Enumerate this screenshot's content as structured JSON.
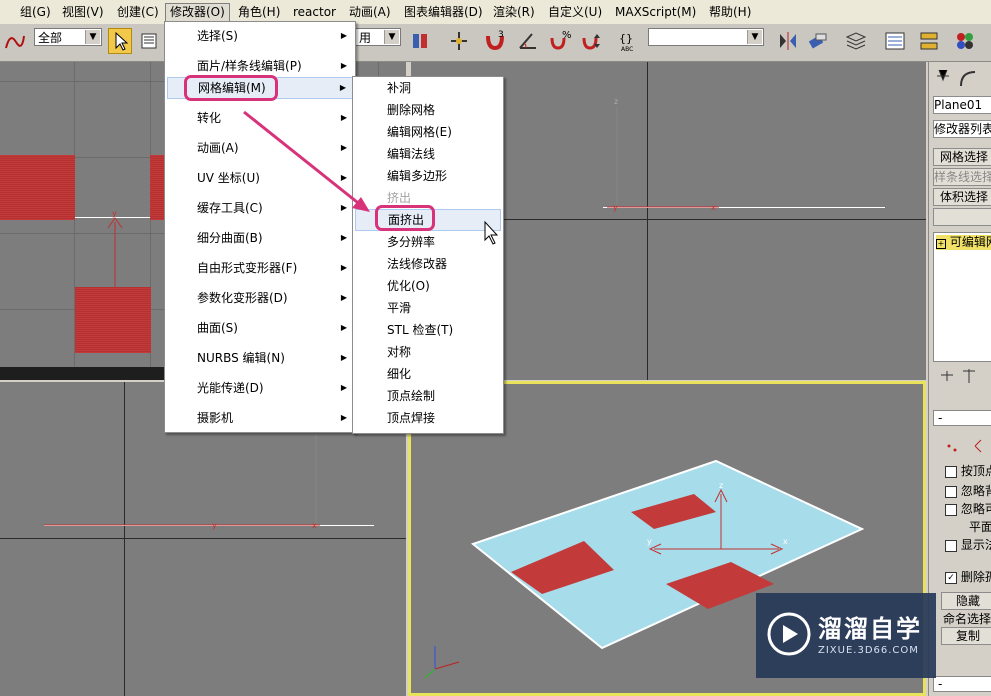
{
  "menubar": {
    "items": [
      "组(G)",
      "视图(V)",
      "创建(C)",
      "修改器(O)",
      "角色(H)",
      "reactor",
      "动画(A)",
      "图表编辑器(D)",
      "渲染(R)",
      "自定义(U)",
      "MAXScript(M)",
      "帮助(H)"
    ]
  },
  "toolbar": {
    "selection_filter": "全部",
    "left_partial": "用",
    "named_selection": ""
  },
  "modifiers_menu": {
    "items": [
      {
        "label": "选择(S)"
      },
      {
        "label": "面片/样条线编辑(P)"
      },
      {
        "label": "网格编辑(M)"
      },
      {
        "label": "转化"
      },
      {
        "label": "动画(A)"
      },
      {
        "label": "UV 坐标(U)"
      },
      {
        "label": "缓存工具(C)"
      },
      {
        "label": "细分曲面(B)"
      },
      {
        "label": "自由形式变形器(F)"
      },
      {
        "label": "参数化变形器(D)"
      },
      {
        "label": "曲面(S)"
      },
      {
        "label": "NURBS 编辑(N)"
      },
      {
        "label": "光能传递(D)"
      },
      {
        "label": "摄影机"
      }
    ],
    "highlighted": "网格编辑(M)"
  },
  "mesh_edit_submenu": {
    "items": [
      {
        "label": "补洞"
      },
      {
        "label": "删除网格"
      },
      {
        "label": "编辑网格(E)"
      },
      {
        "label": "编辑法线"
      },
      {
        "label": "编辑多边形"
      },
      {
        "label": "挤出",
        "disabled": true
      },
      {
        "label": "面挤出"
      },
      {
        "label": "多分辨率"
      },
      {
        "label": "法线修改器"
      },
      {
        "label": "优化(O)"
      },
      {
        "label": "平滑"
      },
      {
        "label": "STL 检查(T)"
      },
      {
        "label": "对称"
      },
      {
        "label": "细化"
      },
      {
        "label": "顶点绘制"
      },
      {
        "label": "顶点焊接"
      }
    ],
    "highlighted": "面挤出"
  },
  "command_panel": {
    "object_name": "Plane01",
    "modifier_list": "修改器列表",
    "btn_mesh_select": "网格选择",
    "btn_spline_select": "样条线选择",
    "btn_volume_select": "体积选择",
    "stack_item": "可编辑网格",
    "rollout_minus": "-",
    "chk_by_vertex": "按顶点",
    "chk_ignore_back": "忽略背面",
    "chk_ignore_visible": "忽略可见边",
    "plane_label": "平面阈值",
    "chk_show_normals": "显示法线",
    "chk_delete_isolated": "删除孤立顶点",
    "btn_hide": "隐藏",
    "named_sel_label": "命名选择",
    "btn_copy": "复制"
  },
  "watermark": {
    "title": "溜溜自学",
    "url": "ZIXUE.3D66.COM"
  },
  "colors": {
    "menu_highlight": "#e6edf7",
    "annotation": "#d8327a",
    "viewport_bg": "#7d7d7d",
    "plane_fill": "#a7dceb",
    "selected_faces": "#c23a3a",
    "active_viewport_border": "#e8e35a"
  }
}
